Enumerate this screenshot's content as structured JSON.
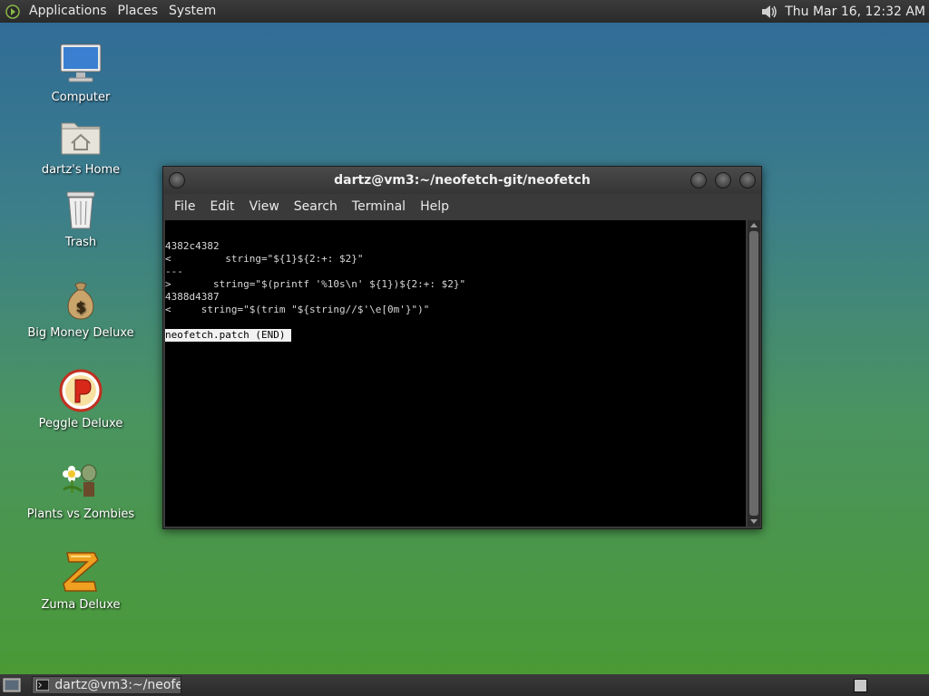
{
  "top_panel": {
    "menus": [
      "Applications",
      "Places",
      "System"
    ],
    "clock": "Thu Mar 16, 12:32 AM"
  },
  "desktop": {
    "icons": [
      {
        "label": "Computer",
        "icon": "computer-icon"
      },
      {
        "label": "dartz's Home",
        "icon": "home-folder-icon"
      },
      {
        "label": "Trash",
        "icon": "trash-icon"
      },
      {
        "label": "Big Money Deluxe",
        "icon": "money-bag-icon"
      },
      {
        "label": "Peggle Deluxe",
        "icon": "peggle-icon"
      },
      {
        "label": "Plants vs Zombies",
        "icon": "plants-vs-zombies-icon"
      },
      {
        "label": "Zuma Deluxe",
        "icon": "zuma-icon"
      }
    ]
  },
  "terminal": {
    "title": "dartz@vm3:~/neofetch-git/neofetch",
    "menus": [
      "File",
      "Edit",
      "View",
      "Search",
      "Terminal",
      "Help"
    ],
    "lines": [
      "4382c4382",
      "<         string=\"${1}${2:+: $2}\"",
      "---",
      ">       string=\"$(printf '%10s\\n' ${1})${2:+: $2}\"",
      "4388d4387",
      "<     string=\"$(trim \"${string//$'\\e[0m'}\")\""
    ],
    "status": "neofetch.patch (END) "
  },
  "taskbar": {
    "window_label": "dartz@vm3:~/neofe..."
  },
  "colors": {
    "panel": "#2f2f2f",
    "terminal_bg": "#000000",
    "terminal_fg": "#d8d8d8"
  }
}
